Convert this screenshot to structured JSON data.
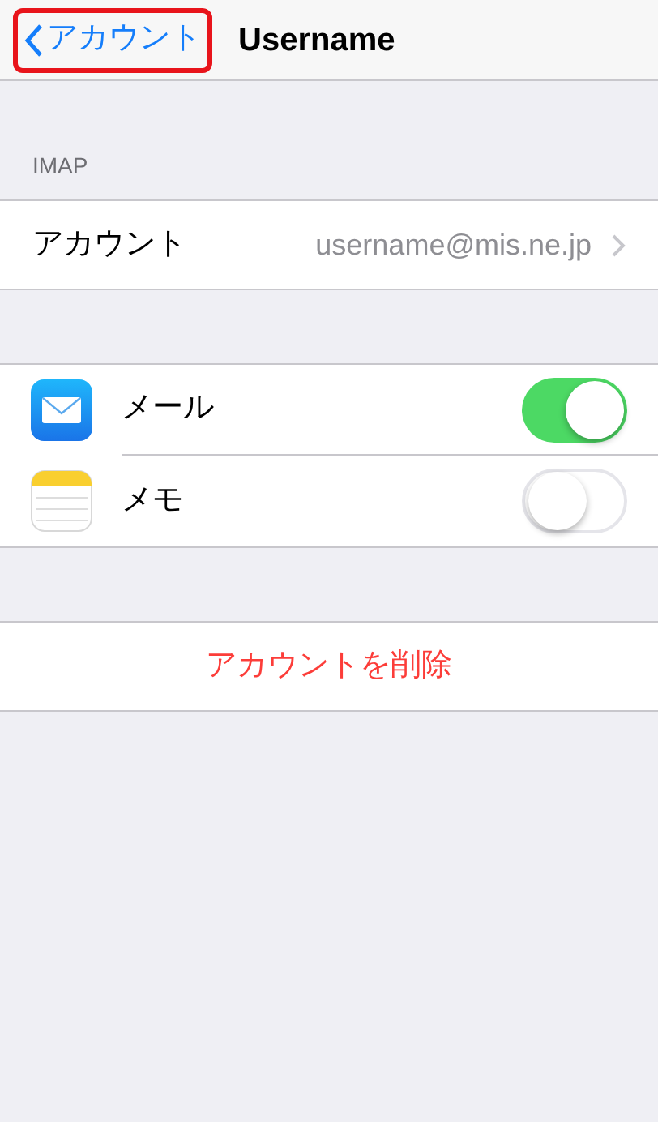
{
  "nav": {
    "back": {
      "label": "アカウント",
      "highlighted": true
    },
    "title": "Username"
  },
  "section_header": "IMAP",
  "account_row": {
    "label": "アカウント",
    "value": "username@mis.ne.jp"
  },
  "toggles": [
    {
      "kind": "mail",
      "label": "メール",
      "on": true
    },
    {
      "kind": "notes",
      "label": "メモ",
      "on": false
    }
  ],
  "delete_button": "アカウントを削除"
}
